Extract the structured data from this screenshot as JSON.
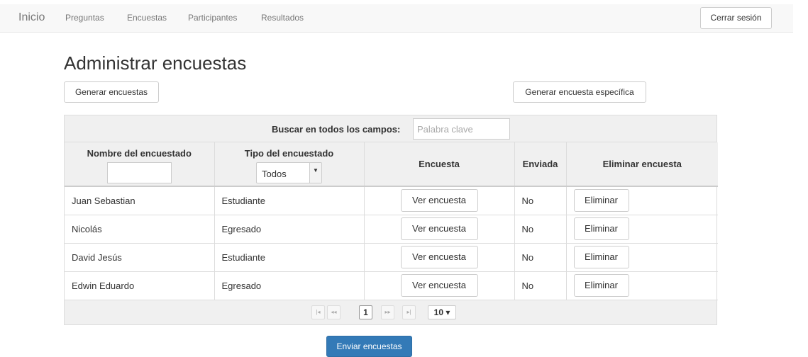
{
  "navbar": {
    "brand": "Inicio",
    "links": [
      "Preguntas",
      "Encuestas",
      "Participantes",
      "Resultados"
    ],
    "logout_label": "Cerrar sesión"
  },
  "page": {
    "title": "Administrar encuestas",
    "generate_label": "Generar encuestas",
    "generate_specific_label": "Generar encuesta específica"
  },
  "table": {
    "search_label": "Buscar en todos los campos:",
    "search_placeholder": "Palabra clave",
    "columns": [
      "Nombre del encuestado",
      "Tipo del encuestado",
      "Encuesta",
      "Enviada",
      "Eliminar encuesta"
    ],
    "type_filter_value": "Todos",
    "view_label": "Ver encuesta",
    "delete_label": "Eliminar",
    "rows": [
      {
        "name": "Juan Sebastian",
        "type": "Estudiante",
        "sent": "No"
      },
      {
        "name": "Nicolás",
        "type": "Egresado",
        "sent": "No"
      },
      {
        "name": "David Jesús",
        "type": "Estudiante",
        "sent": "No"
      },
      {
        "name": "Edwin Eduardo",
        "type": "Egresado",
        "sent": "No"
      }
    ]
  },
  "pager": {
    "first": "|◂",
    "prev": "◂◂",
    "current_page": "1",
    "next": "▸▸",
    "last": "▸|",
    "page_size": "10 ▾"
  },
  "footer": {
    "send_label": "Enviar encuestas"
  },
  "colors": {
    "primary": "#337ab7",
    "navbar_bg": "#f8f8f8",
    "table_header_bg": "#f0f0f0"
  }
}
